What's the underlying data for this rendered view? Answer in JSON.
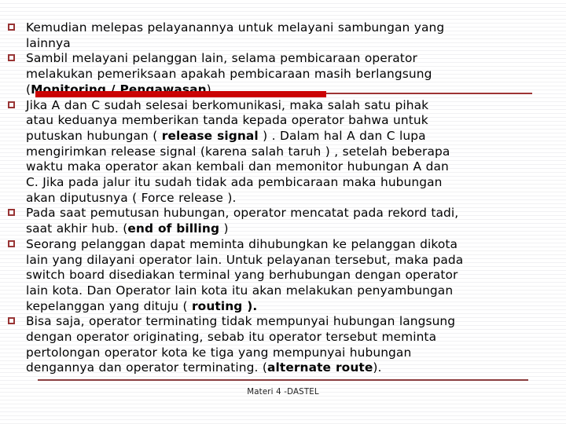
{
  "slide": {
    "bullet_marker": "red-hollow-square",
    "accent_bar_color": "#CC0000",
    "rule_color": "#8B3A3A",
    "text_color": "#000000",
    "background_color": "#FFFFFF",
    "bullets": [
      {
        "id": "bullet-1",
        "lines": [
          [
            {
              "t": "Kemudian melepas pelayanannya untuk melayani sambungan yang",
              "bold": false
            }
          ],
          [
            {
              "t": "lainnya",
              "bold": false
            }
          ]
        ]
      },
      {
        "id": "bullet-2",
        "lines": [
          [
            {
              "t": "Sambil melayani pelanggan lain, selama pembicaraan  operator",
              "bold": false
            }
          ],
          [
            {
              "t": "melakukan pemeriksaan apakah pembicaraan masih berlangsung",
              "bold": false
            }
          ],
          [
            {
              "t": "(",
              "bold": false
            },
            {
              "t": "Monitoring / Pengawasan",
              "bold": true
            },
            {
              "t": ").",
              "bold": false
            }
          ]
        ]
      },
      {
        "id": "bullet-3",
        "lines": [
          [
            {
              "t": "Jika  A dan C sudah selesai berkomunikasi, maka salah satu pihak",
              "bold": false
            }
          ],
          [
            {
              "t": "atau keduanya memberikan tanda kepada operator bahwa untuk",
              "bold": false
            }
          ],
          [
            {
              "t": "putuskan hubungan ( ",
              "bold": false
            },
            {
              "t": "release signal",
              "bold": true
            },
            {
              "t": " ) .  Dalam hal A dan C lupa",
              "bold": false
            }
          ],
          [
            {
              "t": "mengirimkan release signal (karena salah taruh ) , setelah beberapa",
              "bold": false
            }
          ],
          [
            {
              "t": "waktu maka operator akan kembali dan memonitor  hubungan A dan",
              "bold": false
            }
          ],
          [
            {
              "t": "C. Jika pada jalur itu sudah tidak ada pembicaraan maka  hubungan",
              "bold": false
            }
          ],
          [
            {
              "t": "akan diputusnya ( Force release ).",
              "bold": false
            }
          ]
        ]
      },
      {
        "id": "bullet-4",
        "lines": [
          [
            {
              "t": "Pada saat pemutusan hubungan, operator mencatat pada rekord tadi,",
              "bold": false
            }
          ],
          [
            {
              "t": "saat akhir hub. (",
              "bold": false
            },
            {
              "t": "end of billing",
              "bold": true
            },
            {
              "t": " )",
              "bold": false
            }
          ]
        ]
      },
      {
        "id": "bullet-5",
        "lines": [
          [
            {
              "t": "Seorang pelanggan dapat meminta dihubungkan ke pelanggan dikota",
              "bold": false
            }
          ],
          [
            {
              "t": "lain yang dilayani operator lain. Untuk pelayanan tersebut, maka pada",
              "bold": false
            }
          ],
          [
            {
              "t": "switch board disediakan terminal yang berhubungan dengan operator",
              "bold": false
            }
          ],
          [
            {
              "t": "lain kota. Dan Operator lain kota itu akan melakukan penyambungan",
              "bold": false
            }
          ],
          [
            {
              "t": "kepelanggan yang dituju ( ",
              "bold": false
            },
            {
              "t": "routing ).",
              "bold": true
            }
          ]
        ]
      },
      {
        "id": "bullet-6",
        "lines": [
          [
            {
              "t": "Bisa saja, operator terminating tidak mempunyai hubungan langsung",
              "bold": false
            }
          ],
          [
            {
              "t": "dengan operator originating, sebab itu operator tersebut meminta",
              "bold": false
            }
          ],
          [
            {
              "t": "pertolongan operator kota ke tiga yang mempunyai hubungan",
              "bold": false
            }
          ],
          [
            {
              "t": "dengannya dan operator terminating. (",
              "bold": false
            },
            {
              "t": "alternate route",
              "bold": true
            },
            {
              "t": ").",
              "bold": false
            }
          ]
        ]
      }
    ],
    "footer": {
      "text": "Materi 4 -DASTEL"
    }
  }
}
